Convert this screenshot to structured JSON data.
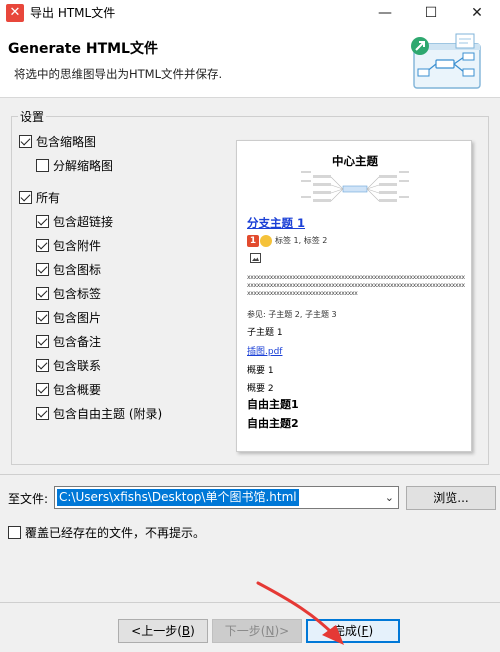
{
  "window": {
    "title": "导出 HTML文件",
    "app_icon_glyph": "✕",
    "controls": {
      "minimize": "—",
      "maximize": "☐",
      "close": "✕"
    }
  },
  "header": {
    "title": "Generate HTML文件",
    "subtitle": "将选中的思维图导出为HTML文件并保存."
  },
  "settings": {
    "legend": "设置",
    "options": [
      {
        "label": "包含缩略图",
        "checked": true
      },
      {
        "label": "分解缩略图",
        "checked": false
      },
      {
        "label": "所有",
        "checked": true
      },
      {
        "label": "包含超链接",
        "checked": true
      },
      {
        "label": "包含附件",
        "checked": true
      },
      {
        "label": "包含图标",
        "checked": true
      },
      {
        "label": "包含标签",
        "checked": true
      },
      {
        "label": "包含图片",
        "checked": true
      },
      {
        "label": "包含备注",
        "checked": true
      },
      {
        "label": "包含联系",
        "checked": true
      },
      {
        "label": "包含概要",
        "checked": true
      },
      {
        "label": "包含自由主题 (附录)",
        "checked": true
      }
    ]
  },
  "preview": {
    "center_topic": "中心主题",
    "branch": "分支主题 1",
    "marker_number": "1",
    "tags": "标签 1, 标签 2",
    "placeholder_text": "xxxxxxxxxxxxxxxxxxxxxxxxxxxxxxxxxxxxxxxxxxxxxxxxxxxxxxxxxxxxxxxxxxxxxxxxxxxxxxxxxxxxxxxxxxxxxxxxxxxxxxxxxxxxxxxxxxxxxxxxxxxxxxxxxxxxxxxxxxxxxxxxxxxxxxxxxxxxxxxxxxxxxxxx",
    "see_also": "参见:  子主题 2, 子主题 3",
    "subtopic": "子主题 1",
    "attachment_link": "插图.pdf",
    "summary1": "概要 1",
    "summary2": "概要 2",
    "free1": "自由主题1",
    "free2": "自由主题2"
  },
  "file": {
    "label": "至文件:",
    "path": "C:\\Users\\xfishs\\Desktop\\单个图书馆.html",
    "browse_label": "浏览..."
  },
  "overwrite": {
    "label": "覆盖已经存在的文件，不再提示。",
    "checked": false
  },
  "buttons": {
    "prev_label": "<上一步(",
    "prev_key": "B",
    "prev_end": ")",
    "next_label": "下一步(",
    "next_key": "N",
    "next_end": ")>",
    "finish_label": "完成(",
    "finish_key": "F",
    "finish_end": ")"
  },
  "colors": {
    "accent": "#0078d7",
    "annotation_arrow": "#e53935",
    "link": "#1a3fd6"
  }
}
